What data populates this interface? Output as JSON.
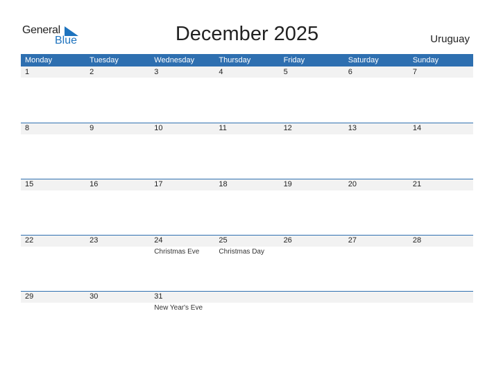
{
  "logo": {
    "line1": "General",
    "line2": "Blue",
    "accent": "#1e73be"
  },
  "title": "December 2025",
  "country": "Uruguay",
  "header_color": "#2e6fb0",
  "weekdays": [
    "Monday",
    "Tuesday",
    "Wednesday",
    "Thursday",
    "Friday",
    "Saturday",
    "Sunday"
  ],
  "weeks": [
    [
      {
        "day": "1",
        "holiday": ""
      },
      {
        "day": "2",
        "holiday": ""
      },
      {
        "day": "3",
        "holiday": ""
      },
      {
        "day": "4",
        "holiday": ""
      },
      {
        "day": "5",
        "holiday": ""
      },
      {
        "day": "6",
        "holiday": ""
      },
      {
        "day": "7",
        "holiday": ""
      }
    ],
    [
      {
        "day": "8",
        "holiday": ""
      },
      {
        "day": "9",
        "holiday": ""
      },
      {
        "day": "10",
        "holiday": ""
      },
      {
        "day": "11",
        "holiday": ""
      },
      {
        "day": "12",
        "holiday": ""
      },
      {
        "day": "13",
        "holiday": ""
      },
      {
        "day": "14",
        "holiday": ""
      }
    ],
    [
      {
        "day": "15",
        "holiday": ""
      },
      {
        "day": "16",
        "holiday": ""
      },
      {
        "day": "17",
        "holiday": ""
      },
      {
        "day": "18",
        "holiday": ""
      },
      {
        "day": "19",
        "holiday": ""
      },
      {
        "day": "20",
        "holiday": ""
      },
      {
        "day": "21",
        "holiday": ""
      }
    ],
    [
      {
        "day": "22",
        "holiday": ""
      },
      {
        "day": "23",
        "holiday": ""
      },
      {
        "day": "24",
        "holiday": "Christmas Eve"
      },
      {
        "day": "25",
        "holiday": "Christmas Day"
      },
      {
        "day": "26",
        "holiday": ""
      },
      {
        "day": "27",
        "holiday": ""
      },
      {
        "day": "28",
        "holiday": ""
      }
    ],
    [
      {
        "day": "29",
        "holiday": ""
      },
      {
        "day": "30",
        "holiday": ""
      },
      {
        "day": "31",
        "holiday": "New Year's Eve"
      },
      {
        "day": "",
        "holiday": ""
      },
      {
        "day": "",
        "holiday": ""
      },
      {
        "day": "",
        "holiday": ""
      },
      {
        "day": "",
        "holiday": ""
      }
    ]
  ]
}
